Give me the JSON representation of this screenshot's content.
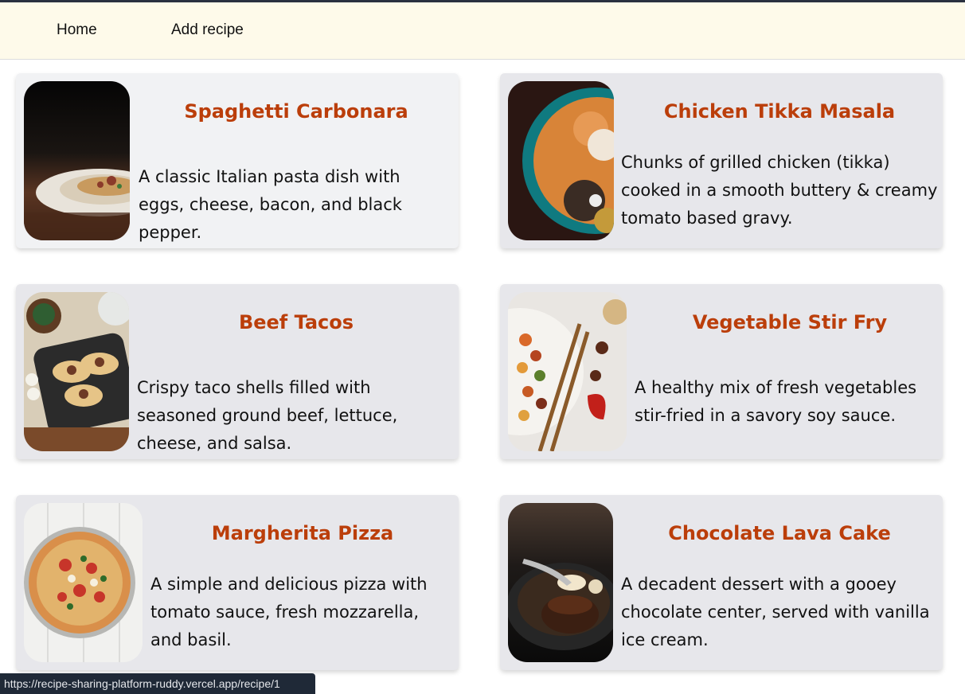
{
  "nav": {
    "home_label": "Home",
    "add_label": "Add recipe"
  },
  "recipes": [
    {
      "title": "Spaghetti Carbonara",
      "description": "A classic Italian pasta dish with eggs, cheese, bacon, and black pepper.",
      "image_icon": "pasta-plate-icon"
    },
    {
      "title": "Chicken Tikka Masala",
      "description": "Chunks of grilled chicken (tikka) cooked in a smooth buttery & creamy tomato based gravy.",
      "image_icon": "curry-bowl-icon"
    },
    {
      "title": "Beef Tacos",
      "description": "Crispy taco shells filled with seasoned ground beef, lettuce, cheese, and salsa.",
      "image_icon": "tacos-tray-icon"
    },
    {
      "title": "Vegetable Stir Fry",
      "description": "A healthy mix of fresh vegetables stir-fried in a savory soy sauce.",
      "image_icon": "stir-fry-plate-icon"
    },
    {
      "title": "Margherita Pizza",
      "description": "A simple and delicious pizza with tomato sauce, fresh mozzarella, and basil.",
      "image_icon": "pizza-icon"
    },
    {
      "title": "Chocolate Lava Cake",
      "description": "A decadent dessert with a gooey chocolate center, served with vanilla ice cream.",
      "image_icon": "lava-cake-icon"
    }
  ],
  "status_bar": {
    "url": "https://recipe-sharing-platform-ruddy.vercel.app/recipe/1"
  },
  "colors": {
    "nav_background": "#fefaea",
    "card_background": "#e7e7eb",
    "title": "#bb3e0a"
  }
}
